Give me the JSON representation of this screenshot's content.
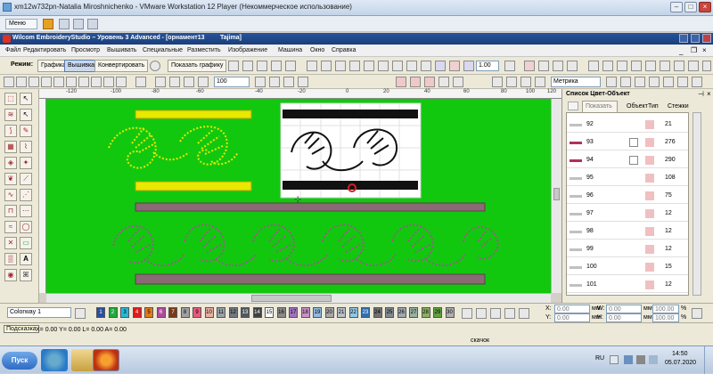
{
  "vm": {
    "title": "xm12w732pn-Natalia Miroshnichenko - VMware Workstation 12 Player (Некоммерческое использование)",
    "menu_label": "Меню"
  },
  "app": {
    "title": "Wilcom EmbroideryStudio – Уровень 3 Advanced - [орнамент13",
    "machine": "Tajima]"
  },
  "menubar": [
    "Файл",
    "Редактировать",
    "Просмотр",
    "Вышивать",
    "Специальные",
    "Разместить",
    "Изображение",
    "Машина",
    "Окно",
    "Справка"
  ],
  "toolbar1": {
    "mode_label": "Режим:",
    "mode_graphic": "Графика",
    "mode_embroidery": "Вышивка",
    "convert": "Конвертировать",
    "show_graphic": "Показать графику",
    "scale_value": "1.00"
  },
  "toolbar2": {
    "zoom_value": "100",
    "units": "Метрика"
  },
  "ruler": {
    "ticks": [
      "-120",
      "-100",
      "-80",
      "-60",
      "-40",
      "-20",
      "0",
      "20",
      "40",
      "60",
      "80",
      "100",
      "120"
    ]
  },
  "panel": {
    "title": "Список Цвет-Объект",
    "show_button": "Показать",
    "col_object": "Объект",
    "col_type": "Тип",
    "col_stitches": "Стежки",
    "rows": [
      {
        "num": "92",
        "stitches": "21",
        "color": "#c0c0c0"
      },
      {
        "num": "93",
        "stitches": "276",
        "color": "#b03060"
      },
      {
        "num": "94",
        "stitches": "290",
        "color": "#b03060"
      },
      {
        "num": "95",
        "stitches": "108",
        "color": "#c0c0c0"
      },
      {
        "num": "96",
        "stitches": "75",
        "color": "#c0c0c0"
      },
      {
        "num": "97",
        "stitches": "12",
        "color": "#c0c0c0"
      },
      {
        "num": "98",
        "stitches": "12",
        "color": "#c0c0c0"
      },
      {
        "num": "99",
        "stitches": "12",
        "color": "#c0c0c0"
      },
      {
        "num": "100",
        "stitches": "15",
        "color": "#c0c0c0"
      },
      {
        "num": "101",
        "stitches": "12",
        "color": "#c0c0c0"
      }
    ]
  },
  "colorway": {
    "name": "Colorway 1",
    "swatches": [
      {
        "n": "1",
        "c": "#2a4fa0"
      },
      {
        "n": "2",
        "c": "#1faa3a"
      },
      {
        "n": "3",
        "c": "#24b8d8"
      },
      {
        "n": "4",
        "c": "#e01a1a"
      },
      {
        "n": "5",
        "c": "#e07a1a"
      },
      {
        "n": "6",
        "c": "#b04a9c"
      },
      {
        "n": "7",
        "c": "#7a3a1a"
      },
      {
        "n": "8",
        "c": "#a0a0a0"
      },
      {
        "n": "9",
        "c": "#e85a7a"
      },
      {
        "n": "10",
        "c": "#e8b0a0"
      },
      {
        "n": "11",
        "c": "#9aa0a8"
      },
      {
        "n": "12",
        "c": "#707880"
      },
      {
        "n": "13",
        "c": "#505860"
      },
      {
        "n": "14",
        "c": "#404040"
      },
      {
        "n": "15",
        "c": "#ffffff"
      },
      {
        "n": "16",
        "c": "#8a8a8a"
      },
      {
        "n": "17",
        "c": "#a070c0"
      },
      {
        "n": "18",
        "c": "#c890c8"
      },
      {
        "n": "19",
        "c": "#90b8e0"
      },
      {
        "n": "20",
        "c": "#a8a8a8"
      },
      {
        "n": "21",
        "c": "#b8c0c8"
      },
      {
        "n": "22",
        "c": "#90c8e8"
      },
      {
        "n": "23",
        "c": "#3070b0"
      },
      {
        "n": "24",
        "c": "#707070"
      },
      {
        "n": "25",
        "c": "#808890"
      },
      {
        "n": "26",
        "c": "#a0a8b0"
      },
      {
        "n": "27",
        "c": "#98b0a0"
      },
      {
        "n": "28",
        "c": "#8ab060"
      },
      {
        "n": "29",
        "c": "#60a040"
      },
      {
        "n": "30",
        "c": "#b0b0b0"
      }
    ]
  },
  "coords": {
    "x_label": "X:",
    "x_val": "0.00",
    "y_label": "Y:",
    "y_val": "0.00",
    "w_label": "W:",
    "w_val": "0.00",
    "h_label": "H:",
    "h_val": "0.00",
    "unit": "мм",
    "pct1": "100.00",
    "pct2": "100.00",
    "pct_sign": "%"
  },
  "status": {
    "tooltip": "Подсказка",
    "readout": "X=   0.00 Y=   0.00 L=   0.00 A=   0.00",
    "bottom": "скачок"
  },
  "taskbar": {
    "start": "Пуск",
    "lang": "RU",
    "time": "14:50",
    "date": "05.07.2020"
  }
}
